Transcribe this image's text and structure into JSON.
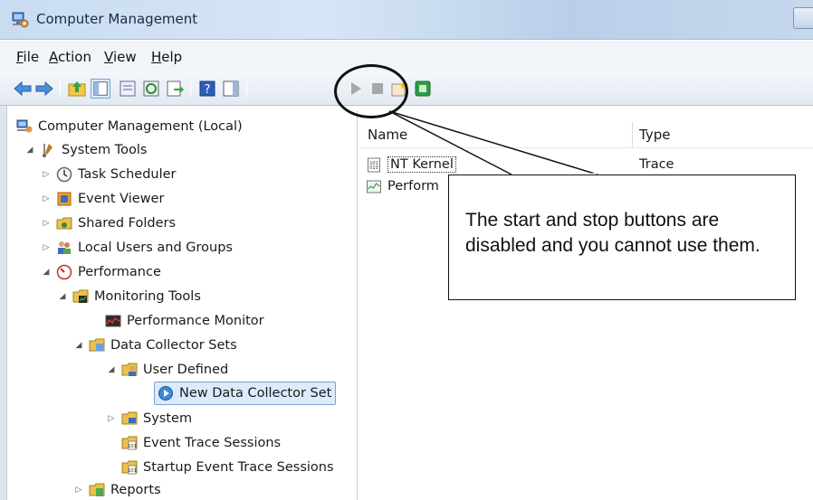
{
  "window": {
    "title": "Computer Management"
  },
  "menu": [
    {
      "first": "F",
      "rest": "ile"
    },
    {
      "first": "A",
      "rest": "ction"
    },
    {
      "first": "V",
      "rest": "iew"
    },
    {
      "first": "H",
      "rest": "elp"
    }
  ],
  "toolbar": {
    "icons": [
      "back-arrow-icon",
      "forward-arrow-icon",
      "up-folder-icon",
      "show-hide-tree-icon",
      "properties-icon",
      "refresh-icon",
      "export-list-icon",
      "help-icon",
      "show-hide-action-pane-icon",
      "start-icon",
      "stop-icon",
      "new-icon",
      "data-collector-icon"
    ],
    "start_state": "disabled",
    "stop_state": "disabled"
  },
  "tree": {
    "root": "Computer Management (Local)",
    "system_tools": "System Tools",
    "task_scheduler": "Task Scheduler",
    "event_viewer": "Event Viewer",
    "shared_folders": "Shared Folders",
    "local_users": "Local Users and Groups",
    "performance": "Performance",
    "monitoring_tools": "Monitoring Tools",
    "performance_monitor": "Performance Monitor",
    "data_collector_sets": "Data Collector Sets",
    "user_defined": "User Defined",
    "new_data_collector_set": "New Data Collector Set",
    "system": "System",
    "event_trace_sessions": "Event Trace Sessions",
    "startup_event_trace": "Startup Event Trace Sessions",
    "reports": "Reports"
  },
  "list": {
    "columns": [
      "Name",
      "Type"
    ],
    "rows": [
      {
        "name": "NT Kernel",
        "type": "Trace"
      },
      {
        "name": "Perform",
        "type": ""
      }
    ]
  },
  "annotation": {
    "text": "The start and stop buttons are disabled and you cannot use them."
  },
  "colors": {
    "title_bar": "#c9dcf2",
    "selection": "#dceafb",
    "annotation_border": "#111111"
  }
}
